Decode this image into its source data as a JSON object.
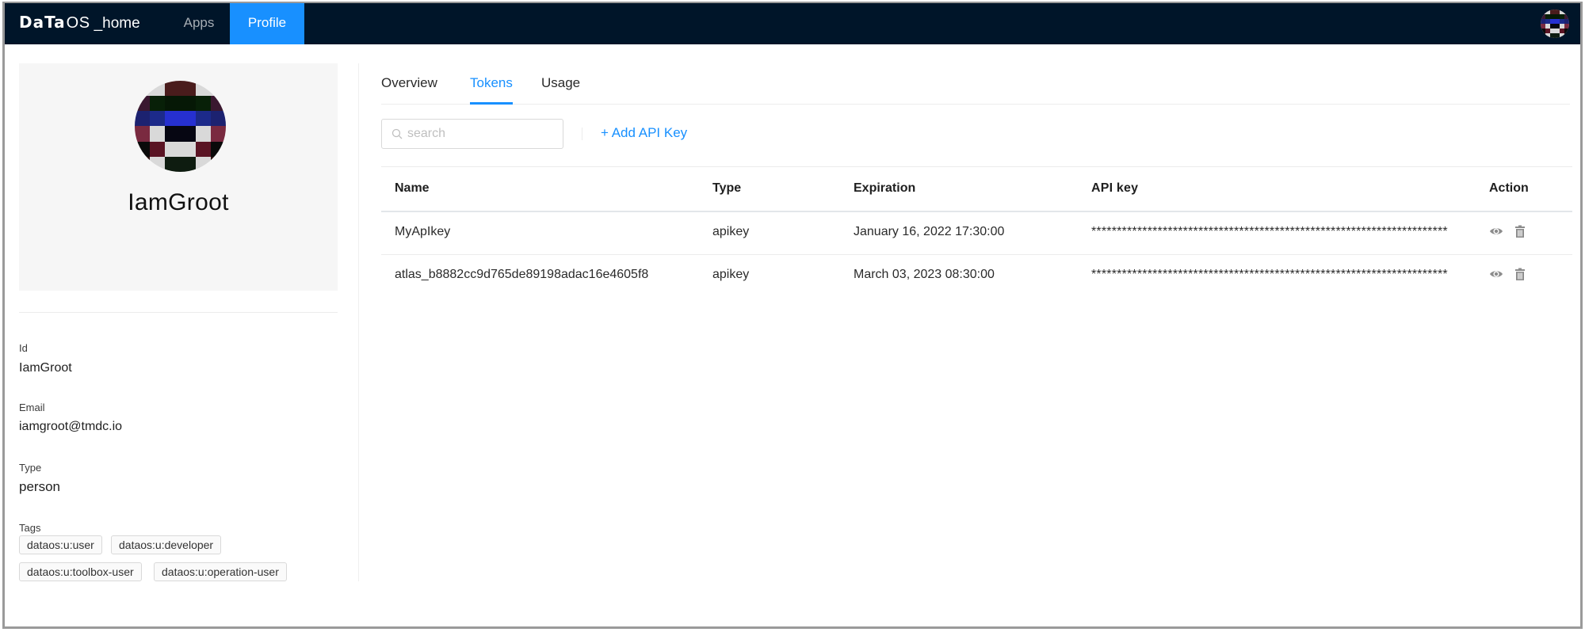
{
  "navbar": {
    "logo_bold": "DaTa",
    "logo_light": "OS",
    "logo_suffix": "_home",
    "items": [
      {
        "label": "Apps",
        "active": false
      },
      {
        "label": "Profile",
        "active": true
      }
    ],
    "accent_color": "#1890ff",
    "background_color": "#001529"
  },
  "profile": {
    "display_name": "IamGroot",
    "fields": [
      {
        "label": "Id",
        "value": "IamGroot"
      },
      {
        "label": "Email",
        "value": "iamgroot@tmdc.io"
      },
      {
        "label": "Type",
        "value": "person"
      }
    ],
    "tags_label": "Tags",
    "tags": [
      "dataos:u:user",
      "dataos:u:developer",
      "dataos:u:toolbox-user",
      "dataos:u:operation-user"
    ]
  },
  "tabs": [
    {
      "label": "Overview",
      "active": false
    },
    {
      "label": "Tokens",
      "active": true
    },
    {
      "label": "Usage",
      "active": false
    }
  ],
  "toolbar": {
    "search_placeholder": "search",
    "search_value": "",
    "add_label": "+ Add API Key"
  },
  "table": {
    "columns": [
      "Name",
      "Type",
      "Expiration",
      "API key",
      "Action"
    ],
    "rows": [
      {
        "name": "MyApIkey",
        "type": "apikey",
        "expiration": "January 16, 2022 17:30:00",
        "api_key": "**********************************************************************",
        "actions": [
          "view-icon",
          "delete-icon"
        ]
      },
      {
        "name": "atlas_b8882cc9d765de89198adac16e4605f8",
        "type": "apikey",
        "expiration": "March 03, 2023 08:30:00",
        "api_key": "**********************************************************************",
        "actions": [
          "view-icon",
          "delete-icon"
        ]
      }
    ]
  }
}
